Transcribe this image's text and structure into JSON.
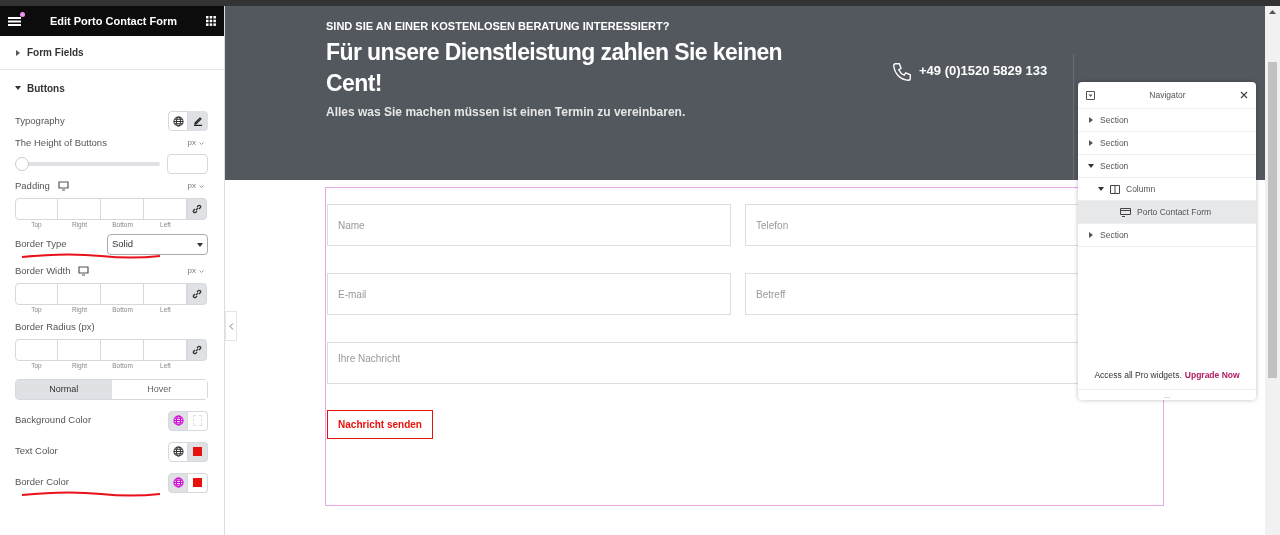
{
  "panel": {
    "title": "Edit Porto Contact Form",
    "sections": [
      {
        "label": "Form Fields",
        "expanded": false
      },
      {
        "label": "Buttons",
        "expanded": true
      }
    ],
    "controls": [
      {
        "kind": "typography",
        "label": "Typography"
      },
      {
        "kind": "slider",
        "label": "The Height of Buttons",
        "unit": "px",
        "level": 0
      },
      {
        "kind": "dimensions",
        "label": "Padding",
        "device": true,
        "unit": "px",
        "sides": [
          "Top",
          "Right",
          "Bottom",
          "Left"
        ]
      },
      {
        "kind": "select",
        "label": "Border Type",
        "value": "Solid",
        "underlined": true
      },
      {
        "kind": "dimensions",
        "label": "Border Width",
        "device": true,
        "unit": "px",
        "sides": [
          "Top",
          "Right",
          "Bottom",
          "Left"
        ]
      },
      {
        "kind": "dimensions",
        "label": "Border Radius (px)",
        "device": false,
        "sides": [
          "Top",
          "Right",
          "Bottom",
          "Left"
        ]
      },
      {
        "kind": "tabs",
        "tabs": [
          {
            "label": "Normal",
            "selected": true
          },
          {
            "label": "Hover",
            "selected": false
          }
        ]
      },
      {
        "kind": "color",
        "label": "Background Color",
        "global": true
      },
      {
        "kind": "color",
        "label": "Text Color",
        "global": false,
        "color": "#e8120c"
      },
      {
        "kind": "color",
        "label": "Border Color",
        "global": true,
        "color": "#e8120c",
        "underlined": true
      }
    ]
  },
  "hero": {
    "eyebrow": "SIND SIE AN EINER KOSTENLOSEN BERATUNG INTERESSIERT?",
    "heading": "Für unsere Dienstleistung zahlen Sie keinen Cent!",
    "subheading": "Alles was Sie machen müssen ist einen Termin zu vereinbaren.",
    "phone": "+49 (0)1520 5829 133"
  },
  "form": {
    "fields": [
      {
        "placeholder": "Name"
      },
      {
        "placeholder": "Telefon"
      },
      {
        "placeholder": "E-mail"
      },
      {
        "placeholder": "Betreff"
      }
    ],
    "message": {
      "placeholder": "Ihre Nachricht"
    },
    "submit": "Nachricht senden"
  },
  "navigator": {
    "title": "Navigator",
    "items": [
      {
        "label": "Section",
        "kind": "section",
        "expanded": false,
        "selected": false
      },
      {
        "label": "Section",
        "kind": "section",
        "expanded": false,
        "selected": false
      },
      {
        "label": "Section",
        "kind": "section",
        "expanded": true,
        "selected": false,
        "children": [
          {
            "label": "Column",
            "kind": "column",
            "expanded": true,
            "selected": false,
            "children": [
              {
                "label": "Porto Contact Form",
                "kind": "widget",
                "selected": true
              }
            ]
          }
        ]
      },
      {
        "label": "Section",
        "kind": "section",
        "expanded": false,
        "selected": false
      }
    ],
    "footer": "Access all Pro widgets.",
    "link": "Upgrade Now",
    "handle": "..."
  }
}
